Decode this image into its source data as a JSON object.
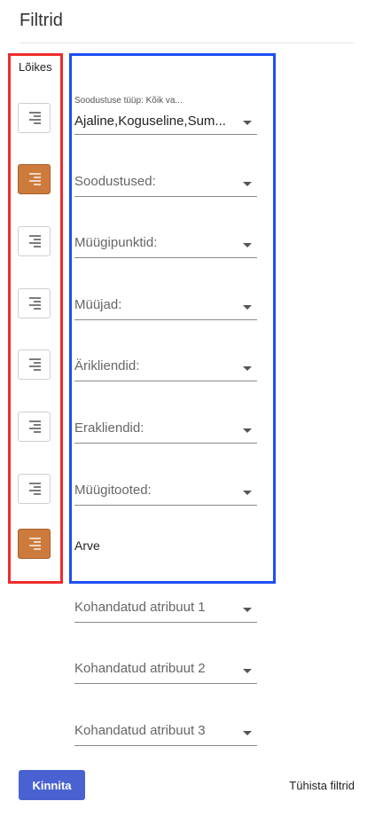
{
  "header": {
    "title": "Filtrid"
  },
  "sidebar": {
    "label": "Lõikes",
    "toggles": [
      {
        "icon": "align-right-icon",
        "active": false
      },
      {
        "icon": "align-right-icon",
        "active": true
      },
      {
        "icon": "align-right-icon",
        "active": false
      },
      {
        "icon": "align-right-icon",
        "active": false
      },
      {
        "icon": "align-right-icon",
        "active": false
      },
      {
        "icon": "align-right-icon",
        "active": false
      },
      {
        "icon": "align-right-icon",
        "active": false
      },
      {
        "icon": "align-right-icon",
        "active": true
      }
    ]
  },
  "filters": {
    "discount_type": {
      "label": "Soodustuse tüüp: Kõik va...",
      "value": "Ajaline,Koguseline,Sum..."
    },
    "discounts": {
      "placeholder": "Soodustused:"
    },
    "sales_points": {
      "placeholder": "Müügipunktid:"
    },
    "sellers": {
      "placeholder": "Müüjad:"
    },
    "business_clients": {
      "placeholder": "Ärikliendid:"
    },
    "private_clients": {
      "placeholder": "Erakliendid:"
    },
    "products": {
      "placeholder": "Müügitooted:"
    },
    "invoice": {
      "label": "Arve"
    },
    "custom_attr_1": {
      "placeholder": "Kohandatud atribuut 1"
    },
    "custom_attr_2": {
      "placeholder": "Kohandatud atribuut 2"
    },
    "custom_attr_3": {
      "placeholder": "Kohandatud atribuut 3"
    }
  },
  "footer": {
    "confirm_label": "Kinnita",
    "clear_label": "Tühista filtrid"
  },
  "colors": {
    "accent": "#4a62d1",
    "active_toggle": "#cd7b3c",
    "red_outline": "#ef2c2c",
    "blue_outline": "#1d4ef5"
  }
}
